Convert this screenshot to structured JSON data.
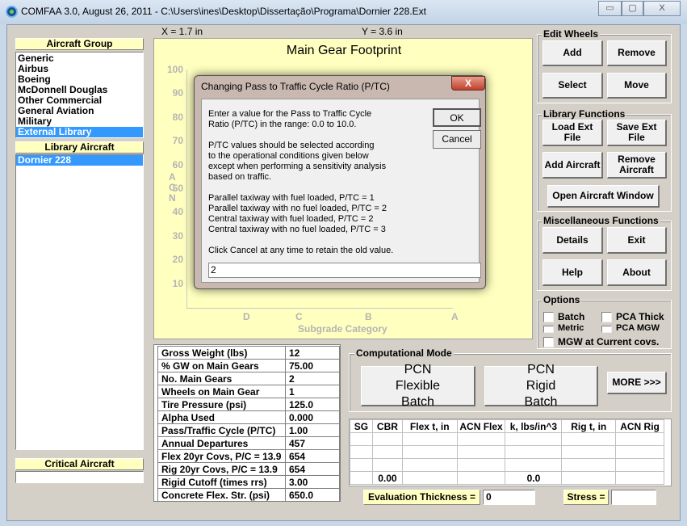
{
  "window": {
    "title": "COMFAA 3.0, August 26, 2011 - C:\\Users\\ines\\Desktop\\Dissertação\\Programa\\Dornier 228.Ext",
    "minimize": "▭",
    "maximize": "▢",
    "close": "X"
  },
  "coords": {
    "x": "X = 1.7 in",
    "y": "Y = 3.6 in"
  },
  "aircraft_group": {
    "header": "Aircraft Group",
    "items": [
      "Generic",
      "Airbus",
      "Boeing",
      "McDonnell Douglas",
      "Other Commercial",
      "General Aviation",
      "Military",
      "External Library"
    ],
    "selected": "External Library"
  },
  "library_aircraft": {
    "header": "Library Aircraft",
    "items": [
      "Dornier 228"
    ],
    "selected": "Dornier 228"
  },
  "critical_aircraft": {
    "header": "Critical Aircraft",
    "value": ""
  },
  "chart": {
    "title": "Main Gear Footprint",
    "y_axis_label": [
      "A",
      "C",
      "N"
    ],
    "y_ticks": [
      "100",
      "90",
      "80",
      "70",
      "60",
      "50",
      "40",
      "30",
      "20",
      "10"
    ],
    "x_ticks": [
      "D",
      "C",
      "B",
      "A"
    ],
    "x_axis_label": "Subgrade Category"
  },
  "dialog": {
    "title": "Changing Pass to Traffic Cycle Ratio (P/TC)",
    "close": "X",
    "para1": "Enter a value for the Pass to Traffic Cycle\nRatio (P/TC) in the range: 0.0 to 10.0.",
    "para2": "P/TC values should be selected according\nto the operational conditions given below\nexcept when performing a sensitivity analysis\nbased on traffic.",
    "para3": "Parallel taxiway with fuel loaded, P/TC = 1\nParallel taxiway with no fuel loaded, P/TC = 2\nCentral taxiway with fuel loaded, P/TC = 2\nCentral taxiway with no fuel loaded, P/TC = 3",
    "para4": "Click Cancel at any time to retain the old value.",
    "input_value": "2",
    "ok": "OK",
    "cancel": "Cancel"
  },
  "edit_wheels": {
    "label": "Edit Wheels",
    "add": "Add",
    "remove": "Remove",
    "select": "Select",
    "move": "Move"
  },
  "library_functions": {
    "label": "Library Functions",
    "load": "Load Ext File",
    "save": "Save Ext File",
    "add": "Add Aircraft",
    "remove": "Remove Aircraft",
    "open": "Open Aircraft Window"
  },
  "misc": {
    "label": "Miscellaneous Functions",
    "details": "Details",
    "exit": "Exit",
    "help": "Help",
    "about": "About"
  },
  "options": {
    "label": "Options",
    "batch": "Batch",
    "pca_thick": "PCA Thick",
    "metric": "Metric",
    "pca_mgw": "PCA MGW",
    "mgw_current": "MGW at Current covs."
  },
  "params": [
    [
      "Gross Weight (lbs)",
      "12"
    ],
    [
      "% GW on Main Gears",
      "75.00"
    ],
    [
      "No. Main Gears",
      "2"
    ],
    [
      "Wheels on Main Gear",
      "1"
    ],
    [
      "Tire Pressure (psi)",
      "125.0"
    ],
    [
      "Alpha Used",
      "0.000"
    ],
    [
      "Pass/Traffic Cycle (P/TC)",
      "1.00"
    ],
    [
      "Annual Departures",
      "457"
    ],
    [
      "Flex 20yr Covs, P/C = 13.9",
      "654"
    ],
    [
      "Rig 20yr Covs,  P/C = 13.9",
      "654"
    ],
    [
      "Rigid Cutoff (times rrs)",
      "3.00"
    ],
    [
      "Concrete Flex. Str. (psi)",
      "650.0"
    ]
  ],
  "computational_mode": {
    "label": "Computational Mode",
    "pcn_flex": "PCN Flexible Batch",
    "pcn_rigid": "PCN Rigid Batch",
    "more": "MORE >>>"
  },
  "results": {
    "headers": [
      "SG",
      "CBR",
      "Flex t, in",
      "ACN Flex",
      "k, lbs/in^3",
      "Rig t, in",
      "ACN Rig"
    ],
    "rows": [
      [
        "",
        "",
        "",
        "",
        "",
        "",
        ""
      ],
      [
        "",
        "",
        "",
        "",
        "",
        "",
        ""
      ],
      [
        "",
        "",
        "",
        "",
        "",
        "",
        ""
      ],
      [
        "",
        "0.00",
        "",
        "",
        "0.0",
        "",
        ""
      ]
    ]
  },
  "evaluation": {
    "label": "Evaluation Thickness =",
    "value": "0",
    "stress_label": "Stress =",
    "stress_value": ""
  }
}
